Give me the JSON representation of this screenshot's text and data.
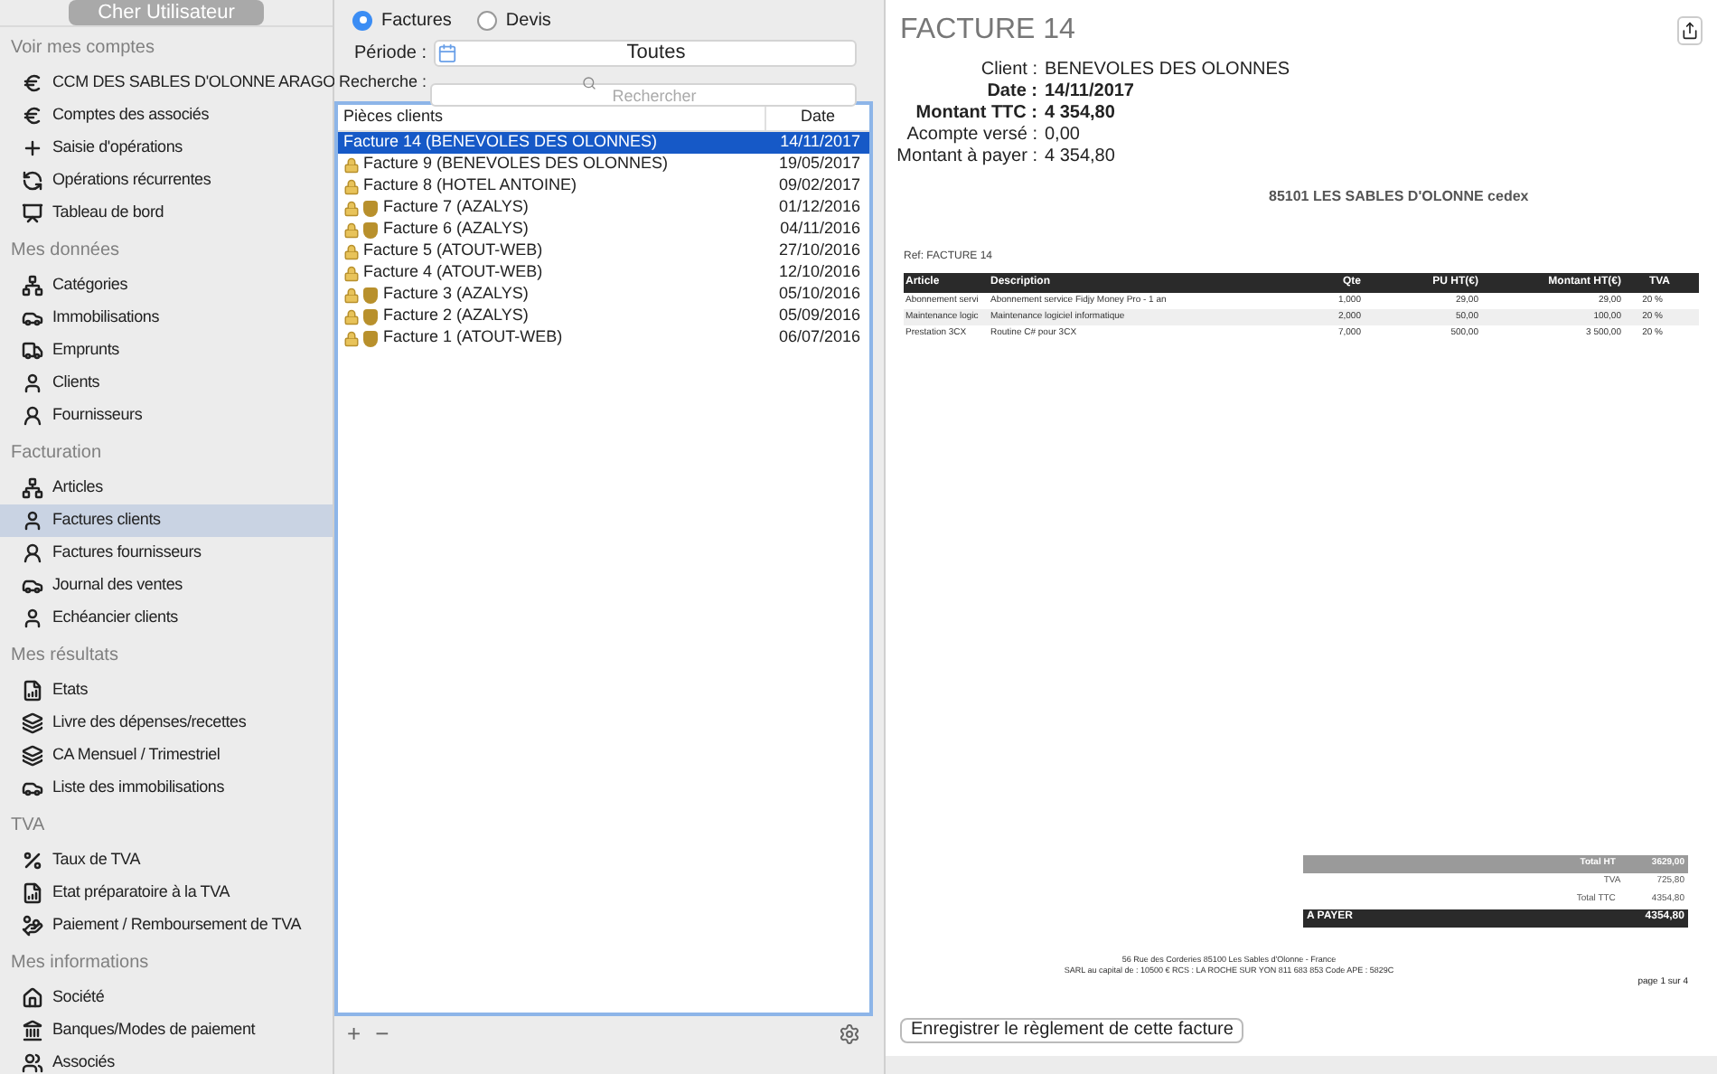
{
  "user_button": "Cher Utilisateur",
  "sidebar": [
    {
      "title": "Voir mes comptes",
      "items": [
        {
          "label": "CCM DES SABLES D'OLONNE ARAGO",
          "selected": false
        },
        {
          "label": "Comptes des associés",
          "selected": false
        },
        {
          "label": "Saisie d'opérations",
          "selected": false
        },
        {
          "label": "Opérations récurrentes",
          "selected": false
        },
        {
          "label": "Tableau de bord",
          "selected": false
        }
      ]
    },
    {
      "title": "Mes données",
      "items": [
        {
          "label": "Catégories",
          "selected": false
        },
        {
          "label": "Immobilisations",
          "selected": false
        },
        {
          "label": "Emprunts",
          "selected": false
        },
        {
          "label": "Clients",
          "selected": false
        },
        {
          "label": "Fournisseurs",
          "selected": false
        }
      ]
    },
    {
      "title": "Facturation",
      "items": [
        {
          "label": "Articles",
          "selected": false
        },
        {
          "label": "Factures clients",
          "selected": true
        },
        {
          "label": "Factures fournisseurs",
          "selected": false
        },
        {
          "label": "Journal des ventes",
          "selected": false
        },
        {
          "label": "Echéancier clients",
          "selected": false
        }
      ]
    },
    {
      "title": "Mes résultats",
      "items": [
        {
          "label": "Etats",
          "selected": false
        },
        {
          "label": "Livre des dépenses/recettes",
          "selected": false
        },
        {
          "label": "CA Mensuel / Trimestriel",
          "selected": false
        },
        {
          "label": "Liste des immobilisations",
          "selected": false
        }
      ]
    },
    {
      "title": "TVA",
      "items": [
        {
          "label": "Taux de TVA",
          "selected": false
        },
        {
          "label": "Etat préparatoire à la TVA",
          "selected": false
        },
        {
          "label": "Paiement / Remboursement de TVA",
          "selected": false
        }
      ]
    },
    {
      "title": "Mes informations",
      "items": [
        {
          "label": "Société",
          "selected": false
        },
        {
          "label": "Banques/Modes de paiement",
          "selected": false
        },
        {
          "label": "Associés",
          "selected": false
        }
      ]
    }
  ],
  "doc_type": [
    {
      "label": "Factures",
      "selected": true
    },
    {
      "label": "Devis",
      "selected": false
    }
  ],
  "period": {
    "label": "Période :",
    "value": "Toutes"
  },
  "search": {
    "label": "Recherche :",
    "placeholder": "Rechercher"
  },
  "list": {
    "columns": [
      "Pièces clients",
      "Date"
    ],
    "rows": [
      {
        "name": "Facture 14 (BENEVOLES DES OLONNES)",
        "date": "14/11/2017",
        "selected": true,
        "locked": false,
        "paid": false
      },
      {
        "name": "Facture 9 (BENEVOLES DES OLONNES)",
        "date": "19/05/2017",
        "selected": false,
        "locked": true,
        "paid": false
      },
      {
        "name": "Facture 8 (HOTEL ANTOINE)",
        "date": "09/02/2017",
        "selected": false,
        "locked": true,
        "paid": false
      },
      {
        "name": "Facture 7 (AZALYS)",
        "date": "01/12/2016",
        "selected": false,
        "locked": true,
        "paid": true
      },
      {
        "name": "Facture 6 (AZALYS)",
        "date": "04/11/2016",
        "selected": false,
        "locked": true,
        "paid": true
      },
      {
        "name": "Facture 5 (ATOUT-WEB)",
        "date": "27/10/2016",
        "selected": false,
        "locked": true,
        "paid": false
      },
      {
        "name": "Facture 4 (ATOUT-WEB)",
        "date": "12/10/2016",
        "selected": false,
        "locked": true,
        "paid": false
      },
      {
        "name": "Facture 3 (AZALYS)",
        "date": "05/10/2016",
        "selected": false,
        "locked": true,
        "paid": true
      },
      {
        "name": "Facture 2 (AZALYS)",
        "date": "05/09/2016",
        "selected": false,
        "locked": true,
        "paid": true
      },
      {
        "name": "Facture 1 (ATOUT-WEB)",
        "date": "06/07/2016",
        "selected": false,
        "locked": true,
        "paid": true
      }
    ]
  },
  "list_footer": {
    "add": "+",
    "remove": "−"
  },
  "invoice": {
    "title": "FACTURE 14",
    "fields": [
      {
        "label": "Client :",
        "value": "BENEVOLES DES OLONNES",
        "bold": false
      },
      {
        "label": "Date :",
        "value": "14/11/2017",
        "bold": true
      },
      {
        "label": "Montant TTC :",
        "value": "4 354,80",
        "bold": true
      },
      {
        "label": "Acompte versé :",
        "value": "0,00",
        "bold": false
      },
      {
        "label": "Montant à payer :",
        "value": "4 354,80",
        "bold": false
      }
    ],
    "address": "85101 LES SABLES D'OLONNE cedex",
    "ref": "Ref: FACTURE 14",
    "columns": [
      "Article",
      "Description",
      "Qte",
      "PU HT(€)",
      "Montant HT(€)",
      "TVA"
    ],
    "lines": [
      [
        "Abonnement servi",
        "Abonnement service Fidjy Money Pro - 1 an",
        "1,000",
        "29,00",
        "29,00",
        "20 %"
      ],
      [
        "Maintenance logic",
        "Maintenance logiciel informatique",
        "2,000",
        "50,00",
        "100,00",
        "20 %"
      ],
      [
        "Prestation 3CX",
        "Routine C# pour 3CX",
        "7,000",
        "500,00",
        "3 500,00",
        "20 %"
      ]
    ],
    "totals": [
      {
        "label": "Total HT",
        "value": "3629,00",
        "kind": "sub"
      },
      {
        "label": "TVA",
        "value": "725,80",
        "kind": "plain"
      },
      {
        "label": "Total TTC",
        "value": "4354,80",
        "kind": "plain"
      },
      {
        "label": "A PAYER",
        "value": "4354,80",
        "kind": "due"
      }
    ],
    "footer": [
      "56 Rue des Corderies 85100 Les Sables d'Olonne - France",
      "SARL au capital de : 10500 € RCS : LA ROCHE SUR YON 811 683 853 Code APE : 5829C"
    ],
    "page": "page 1 sur 4"
  },
  "pay_button": "Enregistrer le règlement de cette facture"
}
